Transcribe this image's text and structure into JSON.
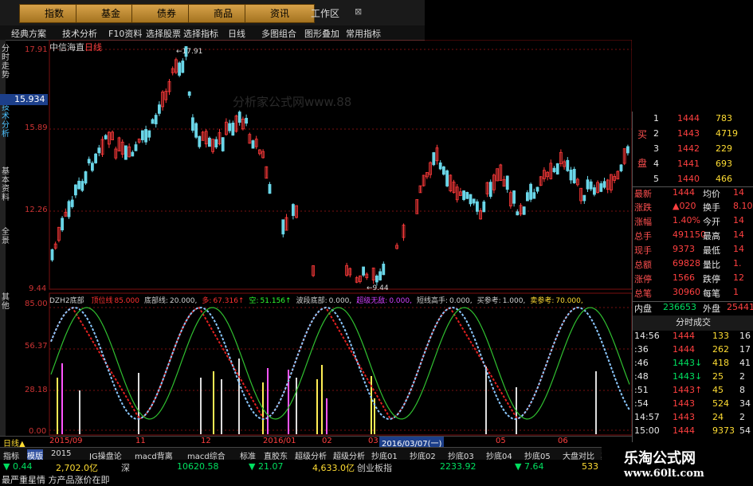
{
  "top_tabs": [
    "指数",
    "基金",
    "债券",
    "商品",
    "资讯"
  ],
  "work_area": {
    "title": "工作区",
    "close": "⊠"
  },
  "menu": [
    "经典方案",
    "技术分析",
    "F10资料",
    "选择股票",
    "选择指标",
    "日线",
    "多图组合",
    "图形叠加",
    "常用指标"
  ],
  "left_tabs": [
    "分时走势",
    "技术分析",
    "基本资料",
    "全景",
    "其他"
  ],
  "chart": {
    "stock_name": "中信海直",
    "period": "日线",
    "watermark": "分析家公式网www.88",
    "price_labels": [
      "17.91",
      "15.89",
      "12.26",
      "9.44"
    ],
    "current_price": "15.934",
    "high_mark": "17.91",
    "low_mark": "9.44"
  },
  "indicator": {
    "name": "DZH2底部",
    "items": [
      {
        "label": "顶位线",
        "value": "85.000",
        "color": "#ff3030"
      },
      {
        "label": "底部线:",
        "value": "20.000,",
        "color": "#d0d0d0"
      },
      {
        "label": "多:",
        "value": "67.316↑",
        "color": "#ff3030"
      },
      {
        "label": "空:",
        "value": "51.156↑",
        "color": "#30ff30"
      },
      {
        "label": "波段底部:",
        "value": "0.000,",
        "color": "#d0d0d0"
      },
      {
        "label": "超级无敌:",
        "value": "0.000,",
        "color": "#d040ff"
      },
      {
        "label": "短线高手:",
        "value": "0.000,",
        "color": "#d0d0d0"
      },
      {
        "label": "买参考:",
        "value": "1.000,",
        "color": "#d0d0d0"
      },
      {
        "label": "卖参考:",
        "value": "70.000,",
        "color": "#ffdd33"
      }
    ],
    "scale": [
      "85.00",
      "56.37",
      "28.18",
      "0.00"
    ]
  },
  "orderbook": {
    "buy_label": "买",
    "disk_label": "盘",
    "rows": [
      {
        "n": "1",
        "price": "1444",
        "vol": "783"
      },
      {
        "n": "2",
        "price": "1443",
        "vol": "4719"
      },
      {
        "n": "3",
        "price": "1442",
        "vol": "229"
      },
      {
        "n": "4",
        "price": "1441",
        "vol": "693"
      },
      {
        "n": "5",
        "price": "1440",
        "vol": "466"
      }
    ]
  },
  "quote": [
    {
      "l1": "最新",
      "v1": "1444",
      "l2": "均价",
      "v2": "14"
    },
    {
      "l1": "涨跌",
      "v1": "▲020",
      "l2": "换手",
      "v2": "8.10"
    },
    {
      "l1": "涨幅",
      "v1": "1.40%",
      "l2": "今开",
      "v2": "14"
    },
    {
      "l1": "总手",
      "v1": "491150",
      "l2": "最高",
      "v2": "14"
    },
    {
      "l1": "现手",
      "v1": "9373",
      "l2": "最低",
      "v2": "14"
    },
    {
      "l1": "总额",
      "v1": "69828",
      "l2": "量比",
      "v2": "1."
    },
    {
      "l1": "涨停",
      "v1": "1566",
      "l2": "跌停",
      "v2": "12"
    },
    {
      "l1": "总笔",
      "v1": "30960",
      "l2": "每笔",
      "v2": "1"
    }
  ],
  "in_out": {
    "in_label": "内盘",
    "in_val": "236653",
    "out_label": "外盘",
    "out_val": "25441"
  },
  "trades_title": "分时成交",
  "trades": [
    {
      "t": "14:56",
      "p": "1444",
      "v": "133",
      "n": "16"
    },
    {
      "t": ":36",
      "p": "1444",
      "v": "262",
      "n": "17"
    },
    {
      "t": ":46",
      "p": "1443↓",
      "v": "418",
      "n": "41"
    },
    {
      "t": ":48",
      "p": "1443↓",
      "v": "25",
      "n": "2"
    },
    {
      "t": ":51",
      "p": "1443↑",
      "v": "45",
      "n": "8"
    },
    {
      "t": ":54",
      "p": "1443",
      "v": "524",
      "n": "34"
    },
    {
      "t": "14:57",
      "p": "1443",
      "v": "24",
      "n": "2"
    },
    {
      "t": "15:00",
      "p": "1444",
      "v": "9373",
      "n": "54"
    }
  ],
  "dates": [
    "日线▲",
    "2015/09",
    "11",
    "12",
    "2016/01",
    "02",
    "03",
    "2016/03/07(一)",
    "05",
    "06"
  ],
  "bottom_tabs": [
    "指标",
    "模版",
    "2015",
    "JG操盘论",
    "macd背离",
    "macd综合",
    "标准",
    "直胶东",
    "超级分析",
    "超级分析",
    "抄底01",
    "抄底02",
    "抄底03",
    "抄底04",
    "抄底05",
    "大盘对比",
    "其"
  ],
  "status": [
    {
      "text": "▼ 0.44",
      "color": "#00e060"
    },
    {
      "text": "2,702.0亿",
      "color": "#ffdd33"
    },
    {
      "text": "深",
      "color": "#d0d0d0"
    },
    {
      "text": "10620.58",
      "color": "#00e060"
    },
    {
      "text": "▼ 21.07",
      "color": "#00e060"
    },
    {
      "text": "4,633.0亿",
      "color": "#ffdd33"
    },
    {
      "text": "创业板指",
      "color": "#d0d0d0"
    },
    {
      "text": "2233.92",
      "color": "#00e060"
    },
    {
      "text": "▼ 7.64",
      "color": "#00e060"
    },
    {
      "text": "533",
      "color": "#ffdd33"
    }
  ],
  "news": "最严重星情 方产品涨价在即",
  "logo": {
    "title": "乐淘公式网",
    "url": "www.60lt.com"
  }
}
